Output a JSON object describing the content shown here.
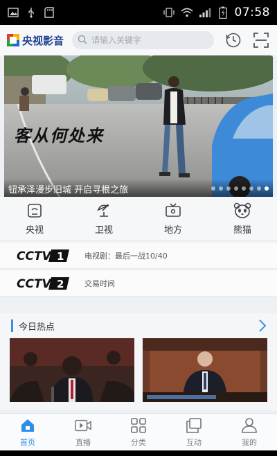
{
  "status_bar": {
    "time": "07:58"
  },
  "header": {
    "app_name": "央视影音",
    "search_placeholder": "请输入关键字"
  },
  "banner": {
    "overlay_title": "客从何处来",
    "caption": "钮承泽漫步旧城 开启寻根之旅",
    "slide_count": 8,
    "active_slide": 8
  },
  "categories": [
    {
      "label": "央视",
      "icon": "tv-screen-icon"
    },
    {
      "label": "卫视",
      "icon": "satellite-dish-icon"
    },
    {
      "label": "地方",
      "icon": "television-icon"
    },
    {
      "label": "熊猫",
      "icon": "panda-icon"
    }
  ],
  "channels": [
    {
      "logo": "CCTV",
      "number": "1",
      "program": "电视剧：最后一战10/40"
    },
    {
      "logo": "CCTV",
      "number": "2",
      "program": "交易时间"
    }
  ],
  "hot": {
    "title": "今日热点"
  },
  "tabs": [
    {
      "label": "首页",
      "icon": "home-icon",
      "active": true
    },
    {
      "label": "直播",
      "icon": "live-play-icon",
      "active": false
    },
    {
      "label": "分类",
      "icon": "grid-category-icon",
      "active": false
    },
    {
      "label": "互动",
      "icon": "interaction-icon",
      "active": false
    },
    {
      "label": "我的",
      "icon": "user-icon",
      "active": false
    }
  ],
  "colors": {
    "accent": "#2f8ee6",
    "logo_blue": "#1e3f8f",
    "status_bar": "#000000",
    "cctv_red": "#d8262c"
  }
}
